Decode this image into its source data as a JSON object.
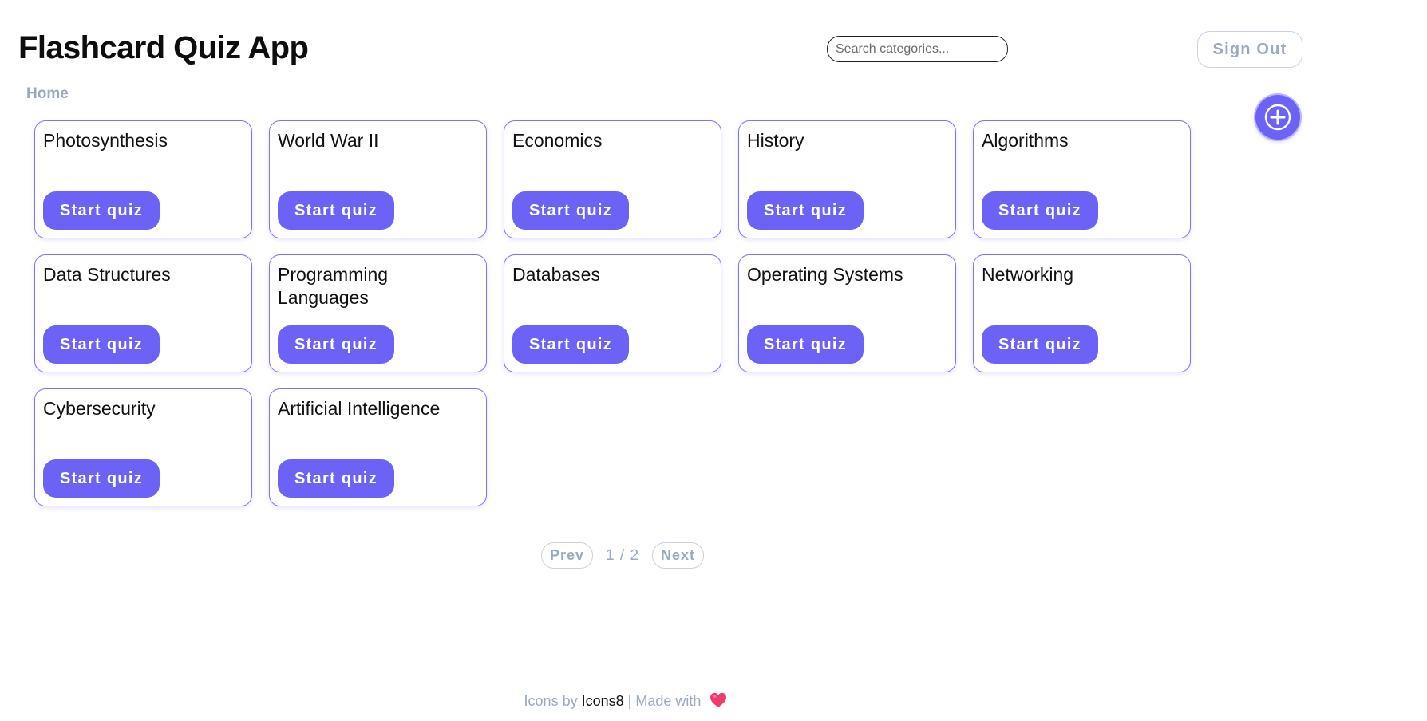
{
  "header": {
    "title": "Flashcard Quiz App",
    "sign_out_label": "Sign Out"
  },
  "search": {
    "placeholder": "Search categories..."
  },
  "breadcrumb": {
    "home_label": "Home"
  },
  "add_button": {
    "icon": "plus-icon"
  },
  "categories": [
    {
      "title": "Photosynthesis",
      "button_label": "Start quiz"
    },
    {
      "title": "World War II",
      "button_label": "Start quiz"
    },
    {
      "title": "Economics",
      "button_label": "Start quiz"
    },
    {
      "title": "History",
      "button_label": "Start quiz"
    },
    {
      "title": "Algorithms",
      "button_label": "Start quiz"
    },
    {
      "title": "Data Structures",
      "button_label": "Start quiz"
    },
    {
      "title": "Programming Languages",
      "button_label": "Start quiz"
    },
    {
      "title": "Databases",
      "button_label": "Start quiz"
    },
    {
      "title": "Operating Systems",
      "button_label": "Start quiz"
    },
    {
      "title": "Networking",
      "button_label": "Start quiz"
    },
    {
      "title": "Cybersecurity",
      "button_label": "Start quiz"
    },
    {
      "title": "Artificial Intelligence",
      "button_label": "Start quiz"
    }
  ],
  "pagination": {
    "prev_label": "Prev",
    "page_text": "1 / 2",
    "next_label": "Next"
  },
  "footer": {
    "prefix": "Icons by",
    "icons_link": "Icons8",
    "separator": "|",
    "made_with": "Made with",
    "heart_icon": "heart-icon"
  },
  "colors": {
    "accent": "#6c63f6",
    "muted": "#9aa9bd",
    "heart": "#ef3b6c"
  }
}
